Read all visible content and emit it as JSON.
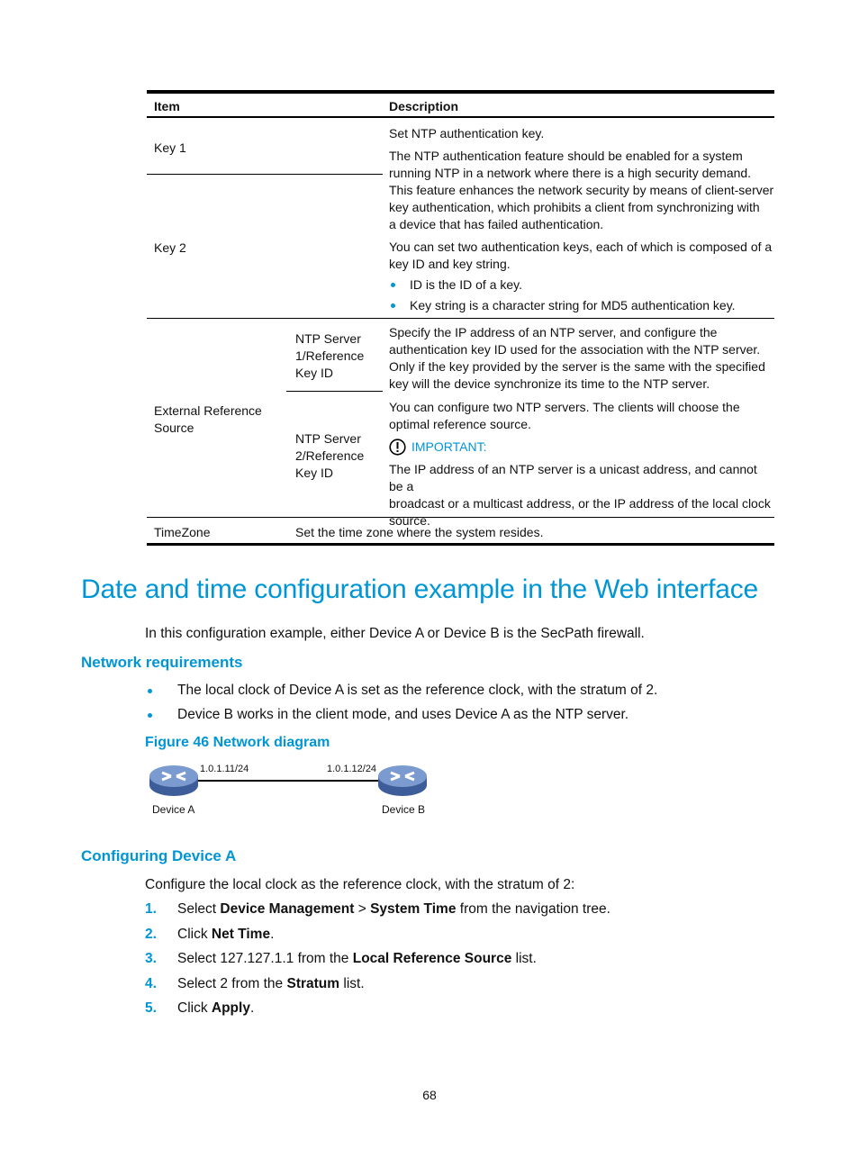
{
  "table": {
    "headers": [
      "Item",
      "Description"
    ],
    "rows": {
      "key1": {
        "item": "Key 1"
      },
      "key2": {
        "item": "Key 2"
      },
      "key_desc": {
        "p1": "Set NTP authentication key.",
        "p2_lines": [
          "The NTP authentication feature should be enabled for a system",
          "running NTP in a network where there is a high security demand.",
          "This feature enhances the network security by means of client-server",
          "key authentication, which prohibits a client from synchronizing with",
          "a device that has failed authentication."
        ],
        "p3_lines": [
          "You can set two authentication keys, each of which is composed of a",
          "key ID and key string."
        ],
        "bullets": [
          "ID is the ID of a key.",
          "Key string is a character string for MD5 authentication key."
        ]
      },
      "external": {
        "item_lines": [
          "External Reference",
          "Source"
        ],
        "sub1_lines": [
          "NTP Server",
          "1/Reference",
          "Key ID"
        ],
        "sub2_lines": [
          "NTP Server",
          "2/Reference",
          "Key ID"
        ],
        "desc1_lines": [
          "Specify the IP address of an NTP server, and configure the",
          "authentication key ID used for the association with the NTP server.",
          "Only if the key provided by the server is the same with the specified",
          "key will the device synchronize its time to the NTP server."
        ],
        "desc2_lines": [
          "You can configure two NTP servers. The clients will choose the",
          "optimal reference source."
        ],
        "important_label": "IMPORTANT:",
        "important_lines": [
          "The IP address of an NTP server is a unicast address, and cannot be a",
          "broadcast or a multicast address, or the IP address of the local clock",
          "source."
        ]
      },
      "timezone": {
        "item": "TimeZone",
        "desc": "Set the time zone where the system resides."
      }
    }
  },
  "section": {
    "title": "Date and time configuration example in the Web interface",
    "intro": "In this configuration example, either Device A or Device B is the SecPath firewall."
  },
  "network_requirements": {
    "heading": "Network requirements",
    "bullets": [
      "The local clock of Device A is set as the reference clock, with the stratum of 2.",
      "Device B works in the client mode, and uses Device A as the NTP server."
    ],
    "figure_caption": "Figure 46 Network diagram"
  },
  "diagram": {
    "device_a": {
      "label": "Device A",
      "ip": "1.0.1.11/24"
    },
    "device_b": {
      "label": "Device B",
      "ip": "1.0.1.12/24"
    }
  },
  "configuring_a": {
    "heading": "Configuring Device A",
    "intro": "Configure the local clock as the reference clock, with the stratum of 2:",
    "steps": [
      {
        "num": "1.",
        "pre": "Select ",
        "b1": "Device Management",
        "mid": " > ",
        "b2": "System Time",
        "post": " from the navigation tree."
      },
      {
        "num": "2.",
        "pre": "Click ",
        "b1": "Net Time",
        "post": "."
      },
      {
        "num": "3.",
        "pre": "Select 127.127.1.1 from the ",
        "b1": "Local Reference Source",
        "post": " list."
      },
      {
        "num": "4.",
        "pre": "Select 2 from the ",
        "b1": "Stratum",
        "post": " list."
      },
      {
        "num": "5.",
        "pre": "Click ",
        "b1": "Apply",
        "post": "."
      }
    ]
  },
  "page_number": "68"
}
